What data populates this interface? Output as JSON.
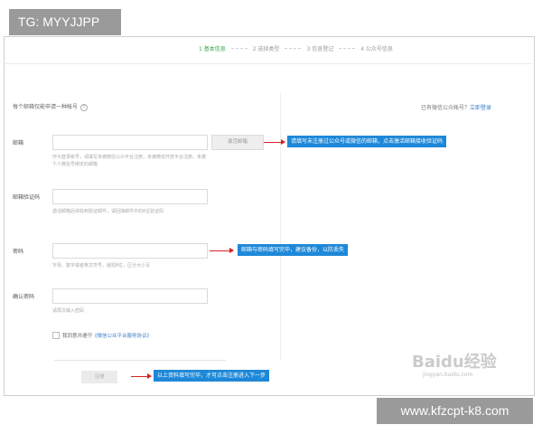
{
  "overlay": {
    "top_tag": "TG: MYYJJPP",
    "bottom_tag": "www.kfzcpt-k8.com"
  },
  "steps": [
    {
      "label": "1 基本信息",
      "active": true
    },
    {
      "label": "2 选择类型",
      "active": false
    },
    {
      "label": "3 信息登记",
      "active": false
    },
    {
      "label": "4 公众号信息",
      "active": false
    }
  ],
  "form": {
    "hint": "每个邮箱仅能申请一种帐号",
    "login_prompt": "已有微信公众帐号？",
    "login_link": "立即登录",
    "email": {
      "label": "邮箱",
      "value": "",
      "help": "作为登录帐号，请填写未被微信公众平台注册，未被微信开放平台注册，未被个人微信号绑定的邮箱"
    },
    "activate_button": "激活邮箱",
    "code": {
      "label": "邮箱验证码",
      "value": "",
      "help": "激活邮箱后将收到验证邮件，请回填邮件中的6位验证码"
    },
    "password": {
      "label": "密码",
      "value": "",
      "help": "字母、数字或者英文符号，最短8位，区分大小写"
    },
    "confirm": {
      "label": "确认密码",
      "value": "",
      "help": "请再次输入密码"
    },
    "agree_prefix": "我同意并遵守",
    "agree_link": "《微信公众平台服务协议》",
    "register_button": "注册"
  },
  "callouts": {
    "email": "请填写未注册过公众号或微信的邮箱，点击激活邮箱接收验证码",
    "password": "邮箱与密码填写完毕，建议备份，以防丢失",
    "register": "以上资料填写完毕，才可点击注册进入下一步"
  },
  "watermark": {
    "brand": "Baidu经验",
    "url": "jingyan.baidu.com"
  },
  "colors": {
    "callout_bg": "#1e88d8",
    "arrow": "#d82222",
    "active_step": "#3aa845",
    "link": "#3b7fc7"
  }
}
